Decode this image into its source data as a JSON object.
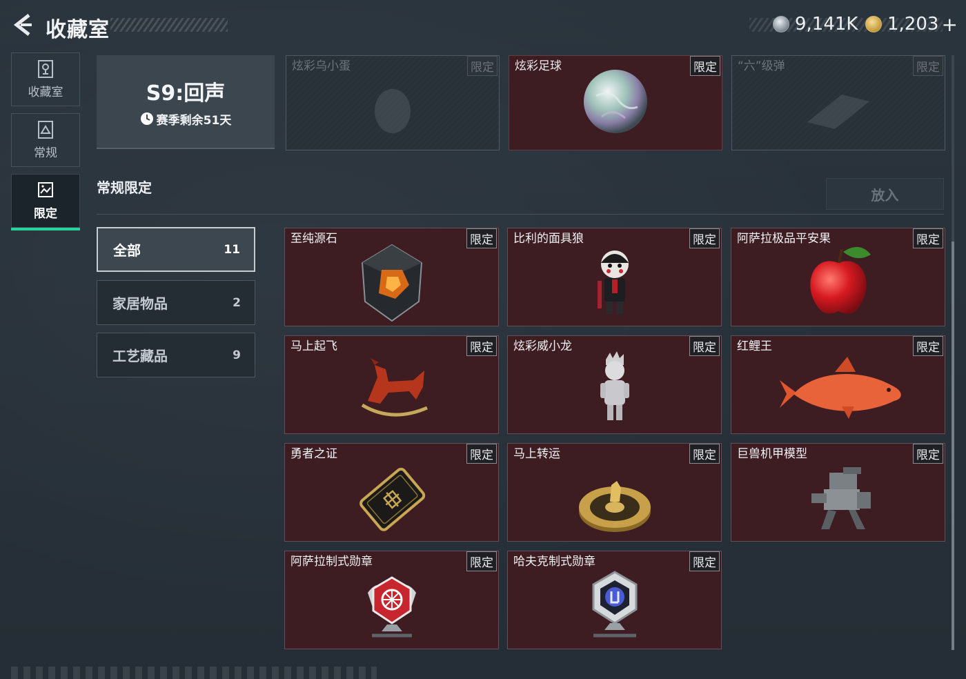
{
  "header": {
    "title": "收藏室",
    "currency": [
      {
        "icon": "silver-coin-icon",
        "value": "9,141K"
      },
      {
        "icon": "gold-coin-icon",
        "value": "1,203"
      }
    ],
    "plus_label": "+"
  },
  "nav": [
    {
      "label": "收藏室",
      "icon": "trophy-icon",
      "active": false
    },
    {
      "label": "常规",
      "icon": "picture-icon",
      "active": false
    },
    {
      "label": "限定",
      "icon": "gallery-icon",
      "active": true
    }
  ],
  "season": {
    "name": "S9:回声",
    "remaining": "赛季剩余51天"
  },
  "top_items": [
    {
      "name": "炫彩乌小蛋",
      "tag": "限定",
      "state": "locked"
    },
    {
      "name": "炫彩足球",
      "tag": "限定",
      "state": "owned"
    },
    {
      "name": "“六”级弹",
      "tag": "限定",
      "state": "locked"
    }
  ],
  "section": {
    "title": "常规限定",
    "put_button": "放入"
  },
  "categories": [
    {
      "label": "全部",
      "count": "11",
      "active": true
    },
    {
      "label": "家居物品",
      "count": "2",
      "active": false
    },
    {
      "label": "工艺藏品",
      "count": "9",
      "active": false
    }
  ],
  "items": [
    {
      "name": "至纯源石",
      "tag": "限定",
      "art": "gem-icon"
    },
    {
      "name": "比利的面具狼",
      "tag": "限定",
      "art": "puppet-icon"
    },
    {
      "name": "阿萨拉极品平安果",
      "tag": "限定",
      "art": "apple-icon"
    },
    {
      "name": "马上起飞",
      "tag": "限定",
      "art": "rocking-horse-icon"
    },
    {
      "name": "炫彩威小龙",
      "tag": "限定",
      "art": "figurine-icon"
    },
    {
      "name": "红鲤王",
      "tag": "限定",
      "art": "carp-icon"
    },
    {
      "name": "勇者之证",
      "tag": "限定",
      "art": "card-icon"
    },
    {
      "name": "马上转运",
      "tag": "限定",
      "art": "roulette-icon"
    },
    {
      "name": "巨兽机甲模型",
      "tag": "限定",
      "art": "mech-icon"
    },
    {
      "name": "阿萨拉制式勋章",
      "tag": "限定",
      "art": "red-medal-icon"
    },
    {
      "name": "哈夫克制式勋章",
      "tag": "限定",
      "art": "silver-medal-icon"
    }
  ]
}
